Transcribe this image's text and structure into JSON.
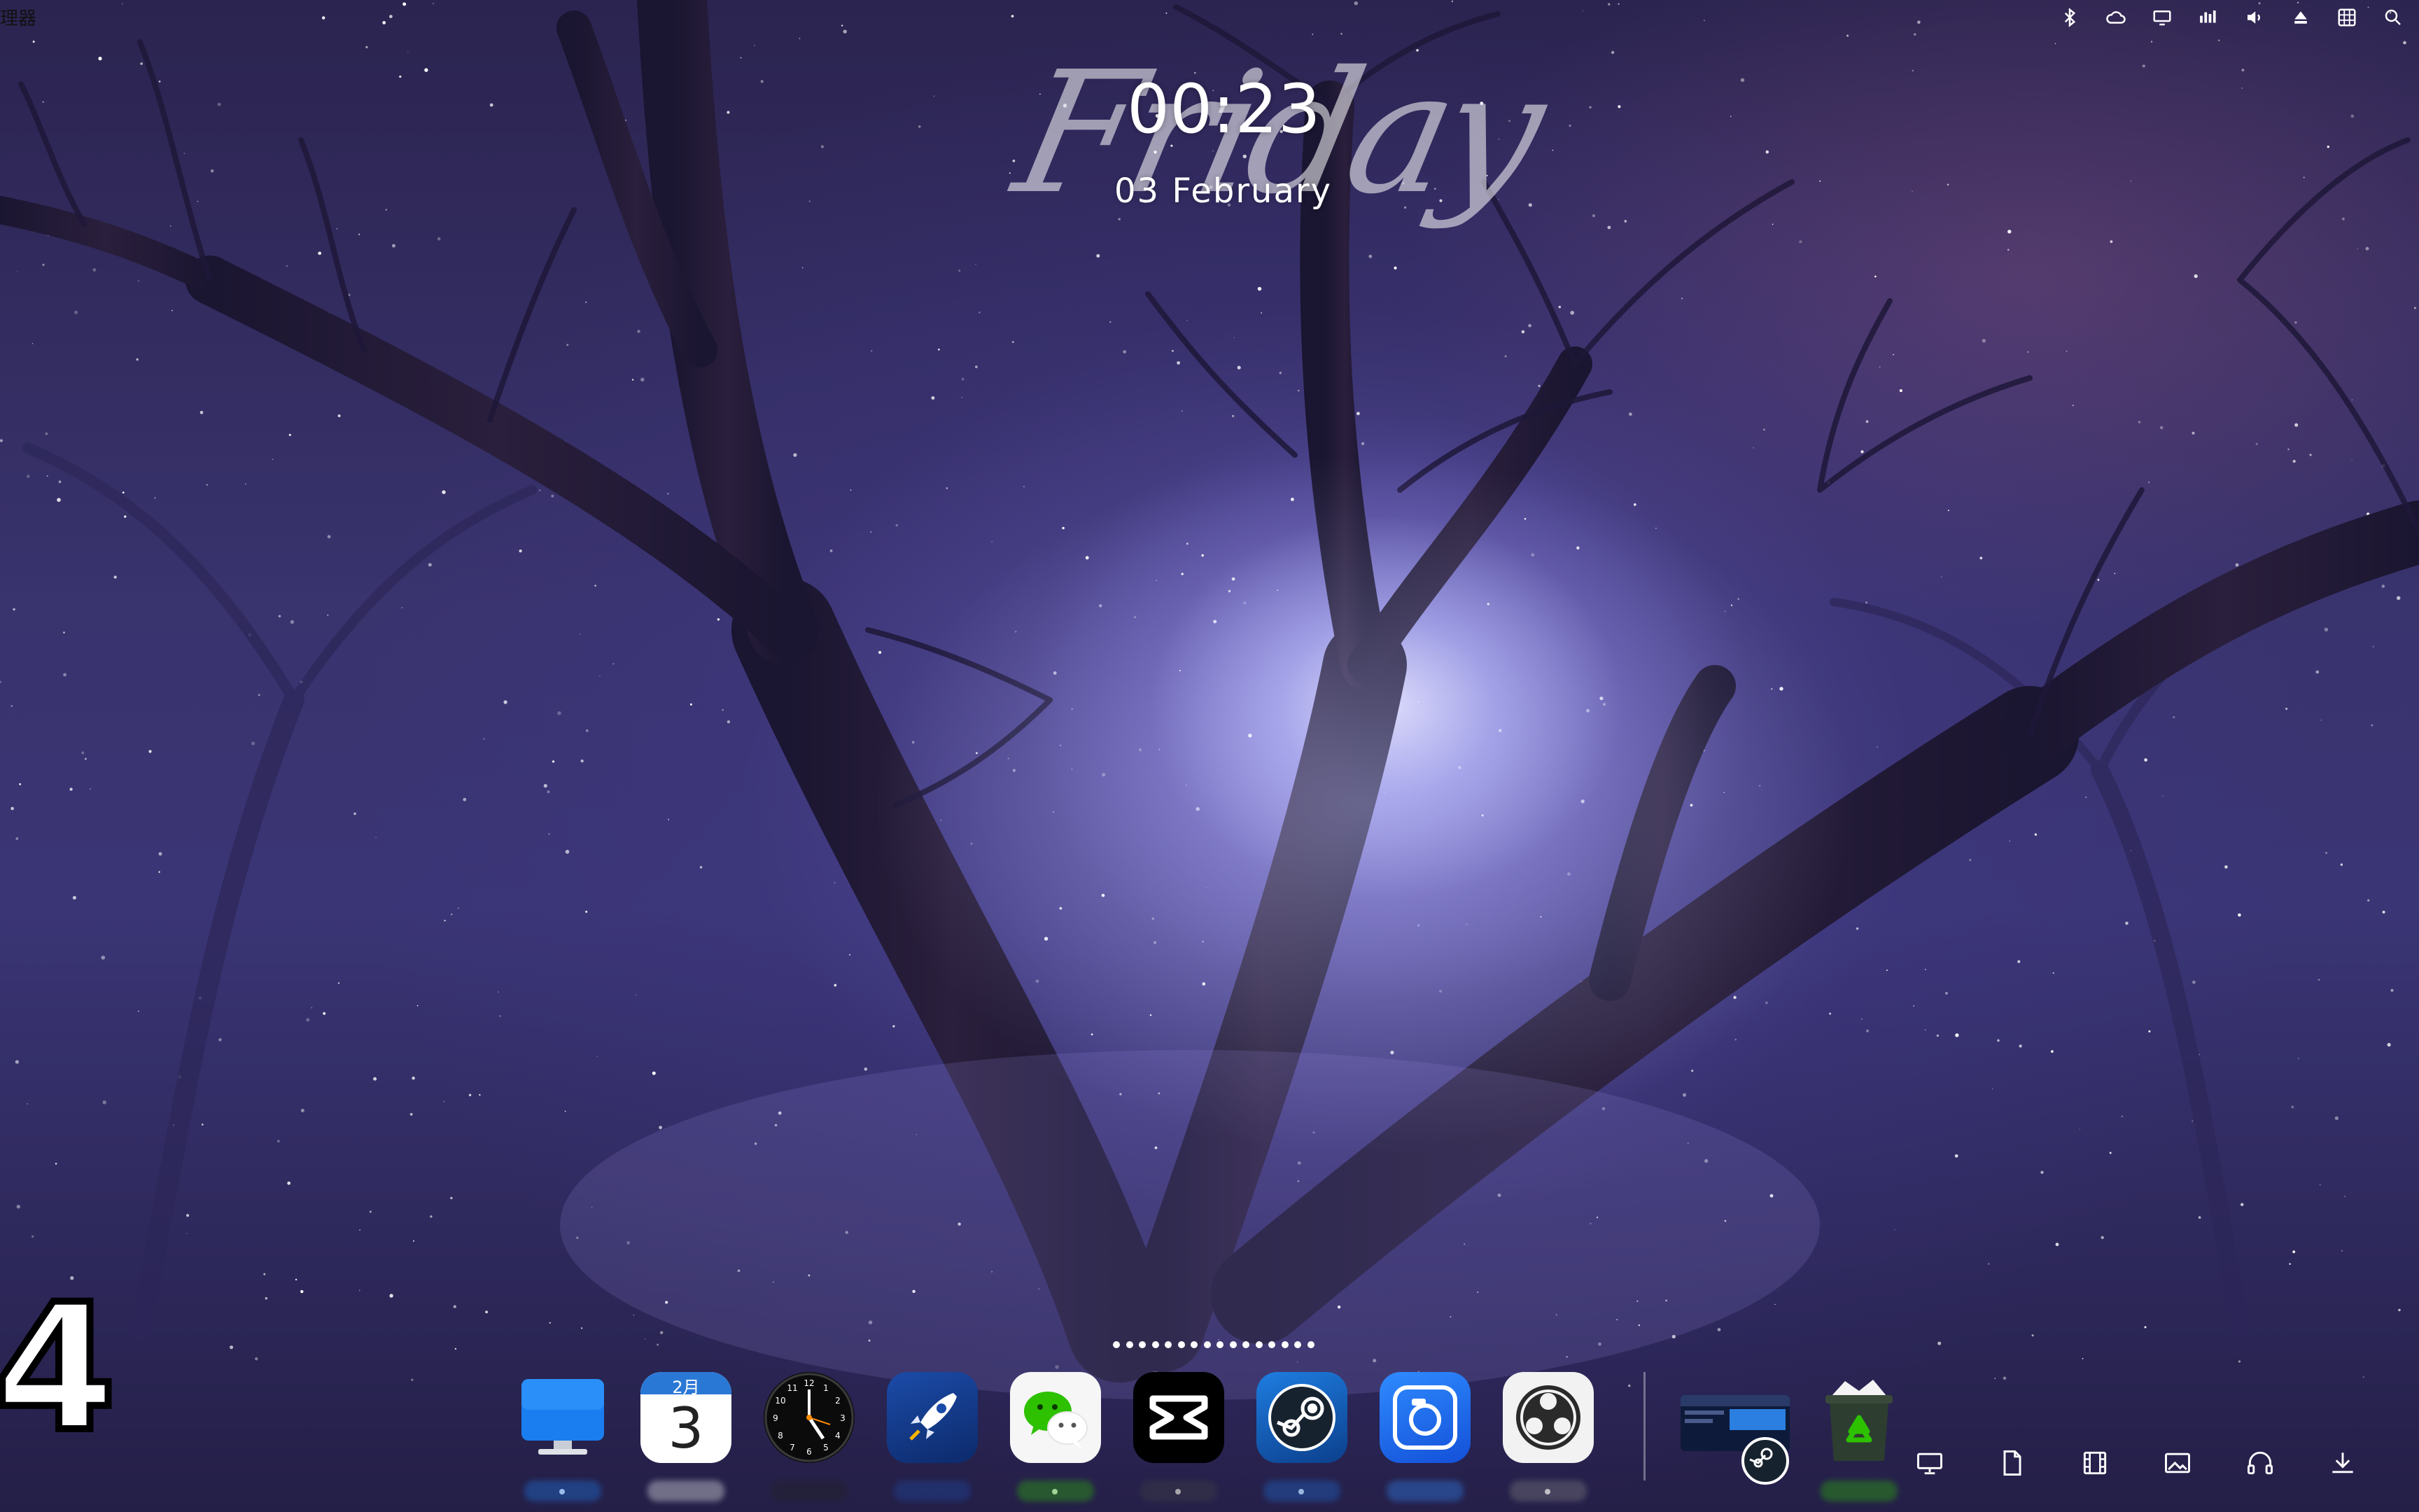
{
  "menubar": {
    "app_name": "理器",
    "tray_icons": [
      "bluetooth-icon",
      "cloud-icon",
      "display-icon",
      "bars-icon",
      "volume-icon",
      "eject-icon",
      "grid-icon",
      "search-icon"
    ]
  },
  "clock": {
    "day_script": "Friday",
    "time": "00:23",
    "date": "03 February"
  },
  "corner_number": "4",
  "page_dots_count": 16,
  "dock": {
    "items": [
      {
        "name": "desktop-app-icon",
        "label": ""
      },
      {
        "name": "calendar-app-icon",
        "month": "2月",
        "day": "3"
      },
      {
        "name": "clock-app-icon"
      },
      {
        "name": "launchpad-rocket-icon"
      },
      {
        "name": "wechat-app-icon"
      },
      {
        "name": "capcut-app-icon"
      },
      {
        "name": "steam-app-icon"
      },
      {
        "name": "screenshot-app-icon"
      },
      {
        "name": "obs-app-icon"
      }
    ],
    "recent": [
      {
        "name": "recent-window-steam-icon"
      },
      {
        "name": "trash-icon"
      }
    ]
  },
  "shelf_icons": [
    "monitor-icon",
    "document-icon",
    "film-icon",
    "image-icon",
    "headphones-icon",
    "download-icon"
  ],
  "colors": {
    "sky_top": "#2b2450",
    "sky_mid": "#3a3575",
    "glow": "#d8d8ff",
    "tree": "#1e1838",
    "wechat_green": "#2dc100",
    "steam_blue": "#1b6fd8"
  }
}
